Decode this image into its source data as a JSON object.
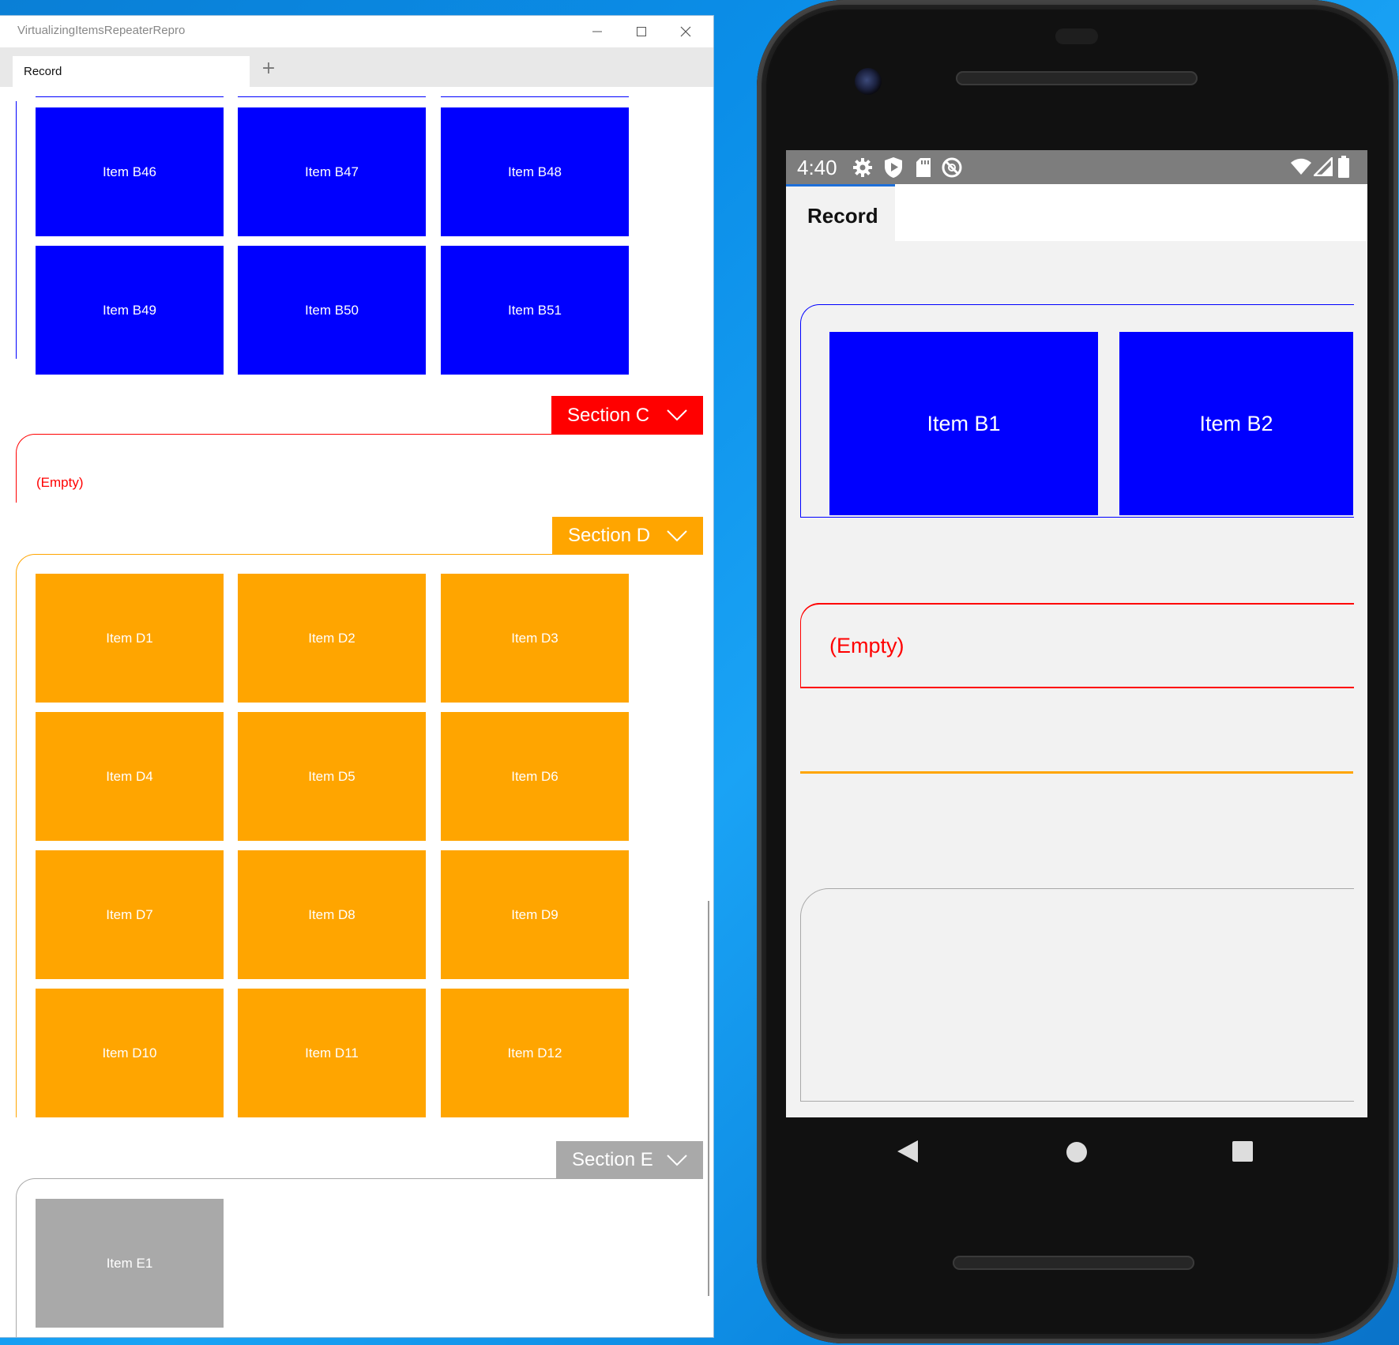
{
  "colors": {
    "section_b": "#0000ff",
    "section_c": "#ff0000",
    "section_d": "#ffa500",
    "section_e": "#a9a9a9"
  },
  "window": {
    "title": "VirtualizingItemsRepeaterRepro",
    "controls": {
      "minimize": "minimize-icon",
      "maximize": "maximize-icon",
      "close": "close-icon"
    },
    "tab": {
      "label": "Record"
    },
    "add_tab": "+"
  },
  "sections": {
    "b": {
      "items": [
        "Item B46",
        "Item B47",
        "Item B48",
        "Item B49",
        "Item B50",
        "Item B51"
      ]
    },
    "c": {
      "title": "Section C",
      "empty_text": "(Empty)"
    },
    "d": {
      "title": "Section D",
      "items": [
        "Item D1",
        "Item D2",
        "Item D3",
        "Item D4",
        "Item D5",
        "Item D6",
        "Item D7",
        "Item D8",
        "Item D9",
        "Item D10",
        "Item D11",
        "Item D12"
      ]
    },
    "e": {
      "title": "Section E",
      "items": [
        "Item E1"
      ]
    }
  },
  "phone": {
    "status": {
      "time": "4:40",
      "left_icons": [
        "gear-icon",
        "shield-play-icon",
        "sd-card-icon",
        "do-not-disturb-icon"
      ],
      "right_icons": [
        "wifi-icon",
        "signal-icon",
        "battery-icon"
      ]
    },
    "tab": {
      "label": "Record"
    },
    "section_b_items": [
      "Item B1",
      "Item B2"
    ],
    "section_c_empty_text": "(Empty)",
    "nav": {
      "back": "back-icon",
      "home": "home-icon",
      "recents": "recents-icon"
    }
  }
}
